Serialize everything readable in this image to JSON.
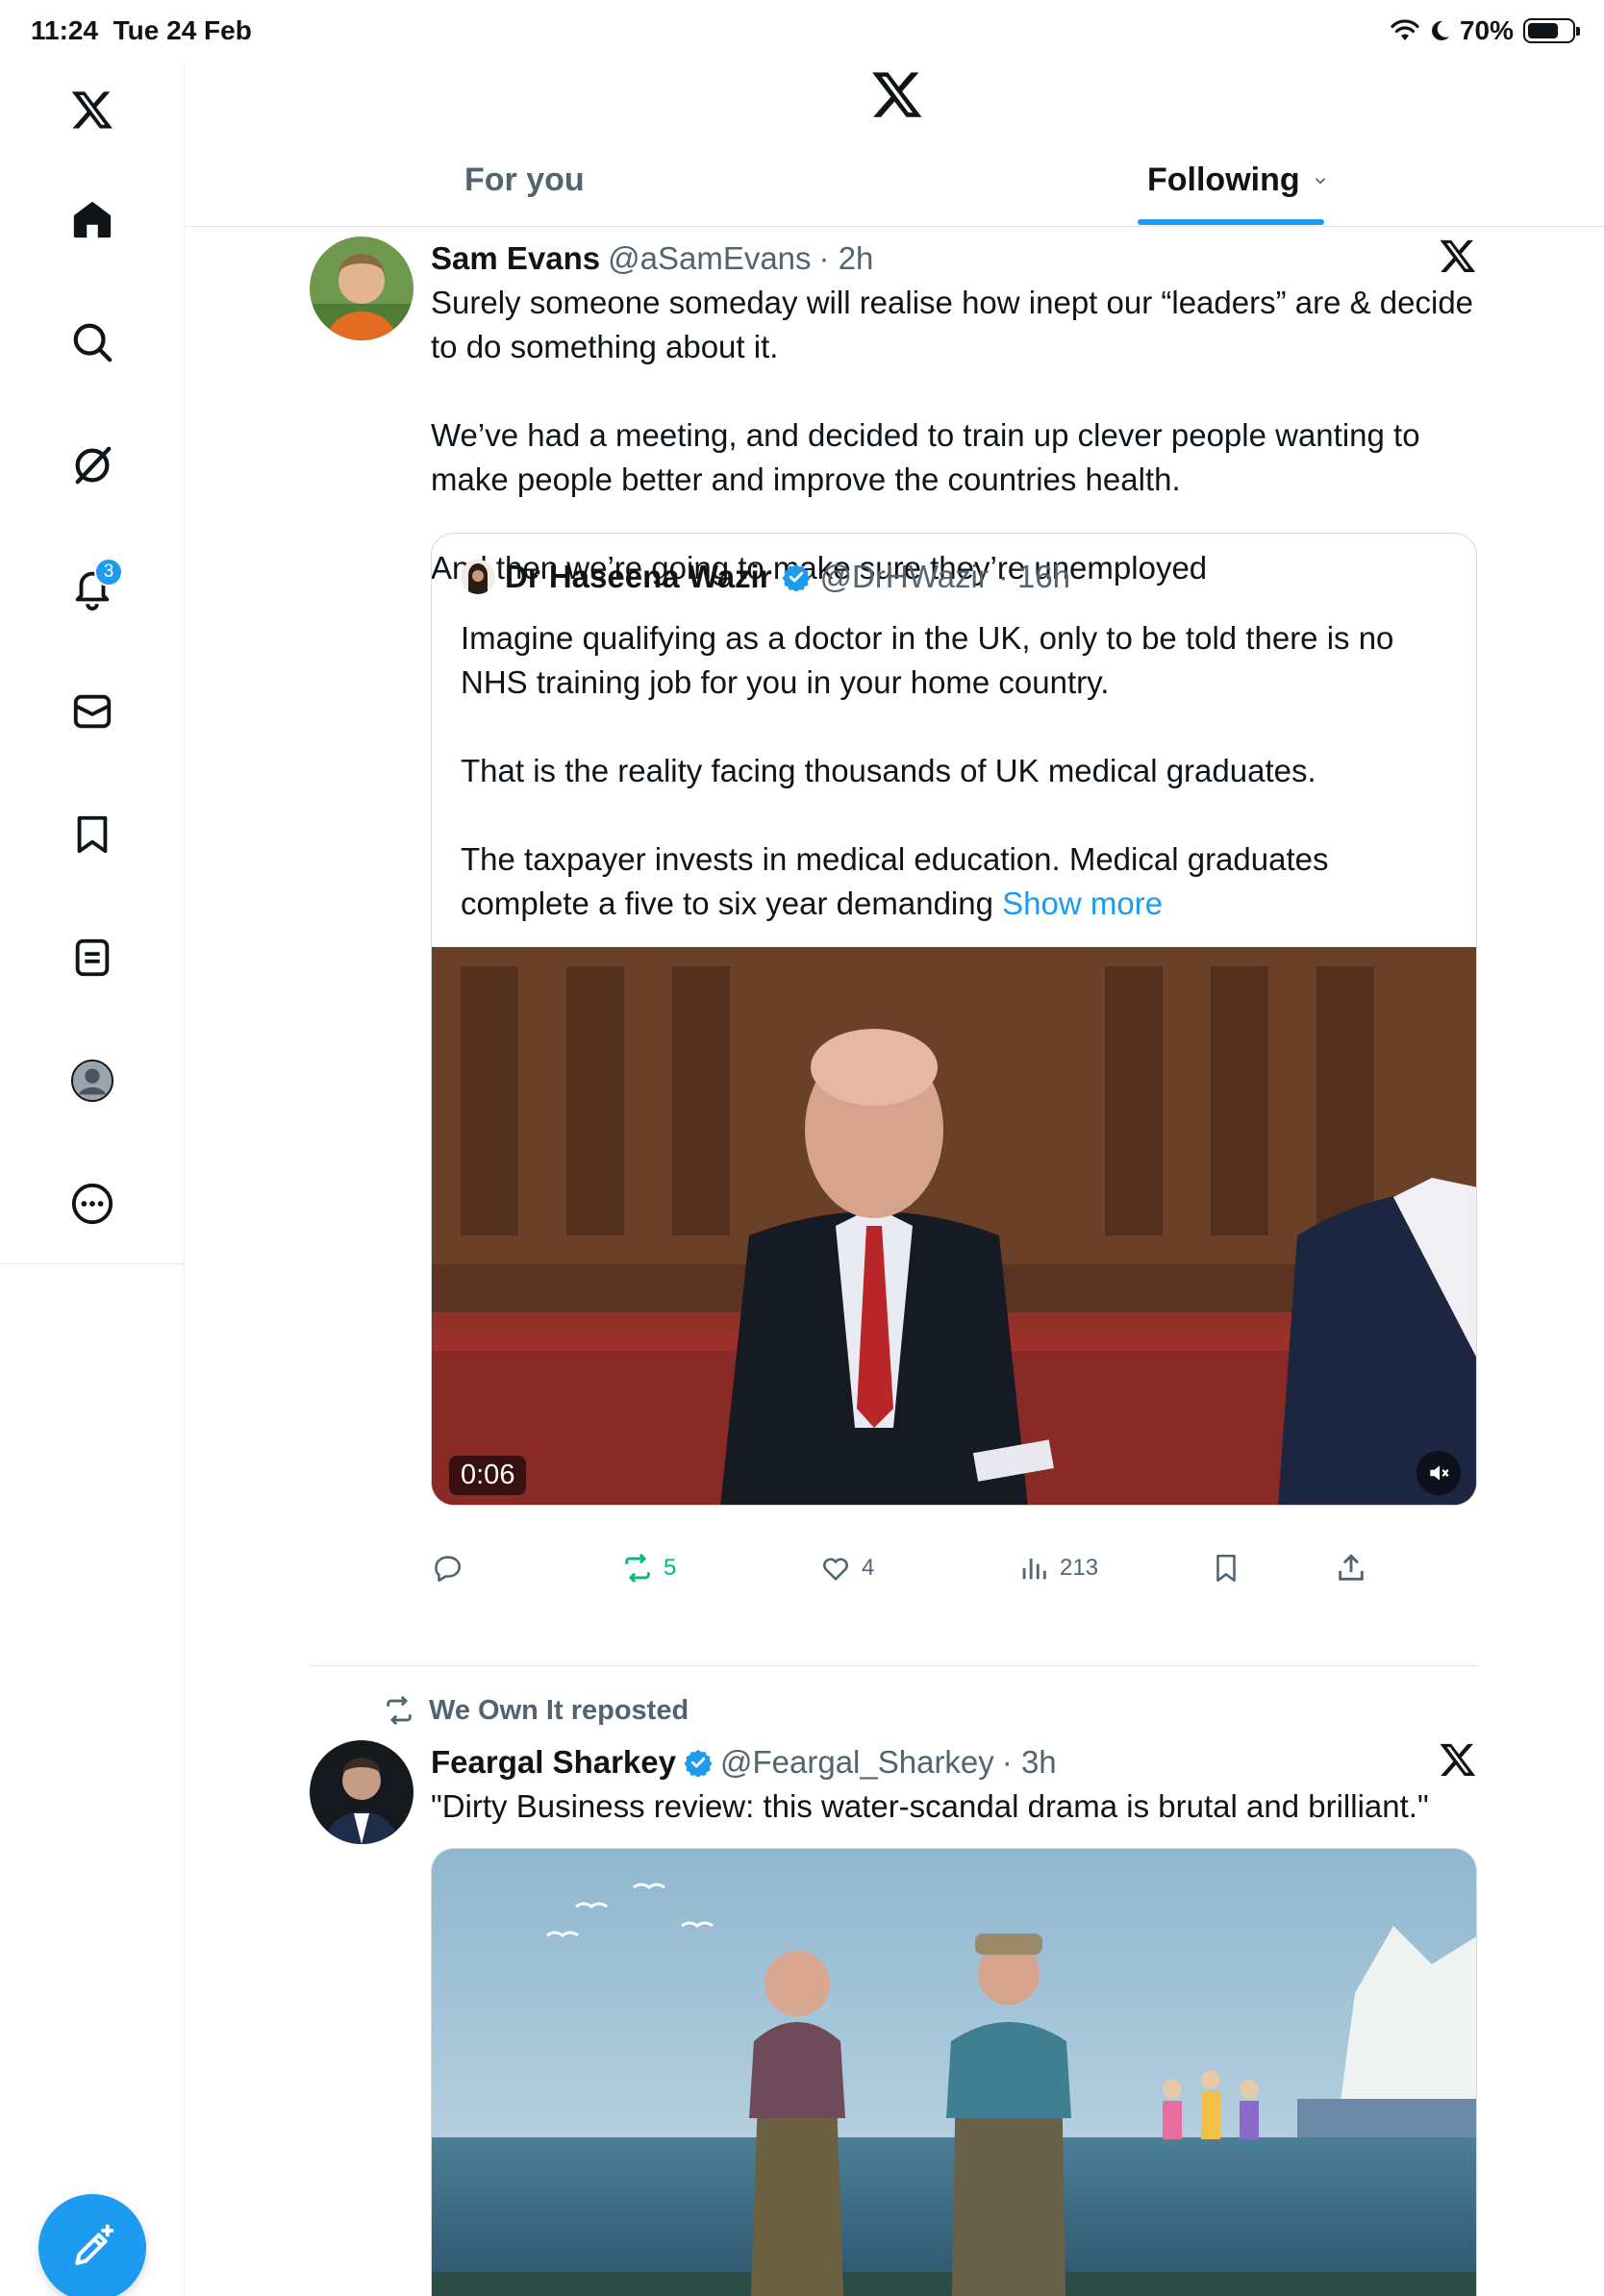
{
  "status_bar": {
    "time": "11:24",
    "date": "Tue 24 Feb",
    "battery": "70%",
    "battery_level": 0.7
  },
  "sidebar": {
    "items": [
      {
        "name": "x-logo-icon"
      },
      {
        "name": "home-icon"
      },
      {
        "name": "search-icon"
      },
      {
        "name": "grok-icon"
      },
      {
        "name": "notifications-icon",
        "badge": "3"
      },
      {
        "name": "messages-icon"
      },
      {
        "name": "bookmarks-icon"
      },
      {
        "name": "lists-icon"
      },
      {
        "name": "profile-icon"
      },
      {
        "name": "more-icon"
      }
    ],
    "compose_icon": "compose-icon"
  },
  "header": {
    "tabs": [
      {
        "label": "For you"
      },
      {
        "label": "Following"
      }
    ]
  },
  "tweets": [
    {
      "name": "Sam Evans",
      "handle": "@aSamEvans",
      "time": "· 2h",
      "text": "Surely someone someday will realise how inept our “leaders” are & decide to do something about it.\n\nWe’ve had a meeting, and decided to train up clever people wanting to make people better and improve the countries health.\n\nAnd then we’re going to make sure they’re unemployed",
      "quote": {
        "name": "Dr Haseena Wazir",
        "handle": "@DrHWazir",
        "time": "· 16h",
        "text": "Imagine qualifying as a doctor in the UK, only to be told there is no NHS training job for you in your home country.\n\nThat is the reality facing thousands of UK medical graduates.\n\nThe taxpayer invests in medical education. Medical graduates complete a five to six year demanding ",
        "show_more": "Show more",
        "video_time": "0:06"
      },
      "actions": {
        "replies": "",
        "reposts": "5",
        "likes": "4",
        "views": "213"
      }
    },
    {
      "repost_by": "We Own It reposted",
      "name": "Feargal Sharkey",
      "handle": "@Feargal_Sharkey",
      "time": "· 3h",
      "text": "\"Dirty Business review: this water-scandal drama is brutal and brilliant.\""
    }
  ],
  "colors": {
    "accent": "#1d9bf0",
    "text": "#0f1419",
    "muted": "#536471",
    "repost": "#00ba7c"
  }
}
